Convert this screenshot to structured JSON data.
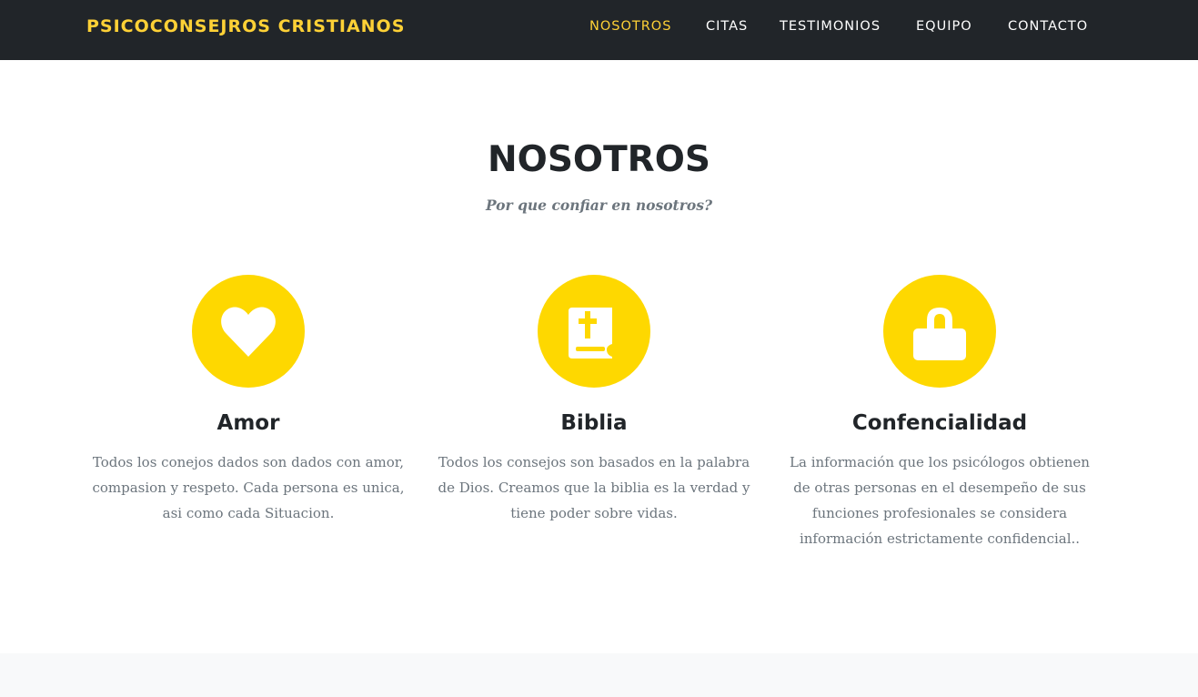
{
  "navbar": {
    "brand": "PSICOCONSEJROS CRISTIANOS",
    "items": [
      {
        "label": "NOSOTROS",
        "active": true
      },
      {
        "label": "CITAS",
        "active": false
      },
      {
        "label": "TESTIMONIOS",
        "active": false
      },
      {
        "label": "EQUIPO",
        "active": false
      },
      {
        "label": "CONTACTO",
        "active": false
      }
    ]
  },
  "section": {
    "heading": "NOSOTROS",
    "subheading": "Por que confiar en nosotros?"
  },
  "features": [
    {
      "icon": "heart-icon",
      "title": "Amor",
      "text": "Todos los conejos dados son dados con amor, compasion y respeto. Cada persona es unica, asi como cada Situacion."
    },
    {
      "icon": "bible-icon",
      "title": "Biblia",
      "text": "Todos los consejos son basados en la palabra de Dios. Creamos que la biblia es la verdad y tiene poder sobre vidas."
    },
    {
      "icon": "lock-icon",
      "title": "Confencialidad",
      "text": "La información que los psicólogos obtienen de otras personas en el desempeño de sus funciones profesionales se considera información estrictamente confidencial.."
    }
  ],
  "colors": {
    "accent": "#fed136",
    "icon_background": "#fed800",
    "navbar_background": "#212529",
    "heading": "#212529",
    "muted_text": "#6c757d"
  }
}
